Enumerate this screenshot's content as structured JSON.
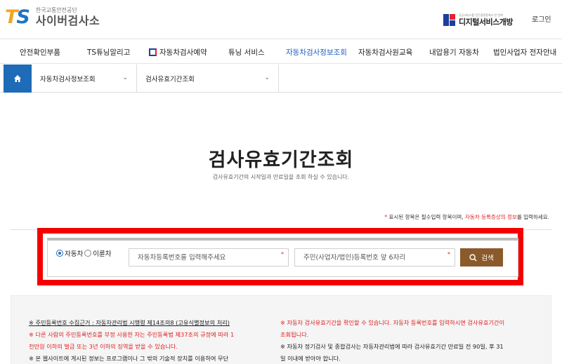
{
  "header": {
    "logo_mark": "TS",
    "org_name": "한국교통안전공단",
    "site_name": "사이버검사소",
    "gov_small": "공공서비스를 민간플랫폼에서 한 번에",
    "gov_title": "디지털서비스개방",
    "login_label": "로그인"
  },
  "gnb": [
    {
      "label": "안전확인부품"
    },
    {
      "label": "TS튜닝알리고"
    },
    {
      "label": "자동차검사예약"
    },
    {
      "label": "튜닝 서비스"
    },
    {
      "label": "자동차검사정보조회"
    },
    {
      "label": "자동차검사원교육"
    },
    {
      "label": "내압용기 자동차"
    },
    {
      "label": "법인사업자 전자안내"
    }
  ],
  "gnb_active": "자동차검사정보조회",
  "location": {
    "level1": "자동차검사정보조회",
    "level2": "검사유효기간조회"
  },
  "page": {
    "title": "검사유효기간조회",
    "subtitle": "검사유효기간의 시작일과 만료일을 조회 하실 수 있습니다."
  },
  "req_note": {
    "star": "*",
    "text1": " 표시된 항목은 필수입력 항목이며, ",
    "red": "자동차 등록증상의 정보",
    "text2": "를 입력하세요."
  },
  "search": {
    "radio_car": "자동차",
    "radio_bike": "이륜차",
    "selected": "자동차",
    "car_no_placeholder": "자동차등록번호를 입력해주세요",
    "id_placeholder": "주민(사업자/법인)등록번호 앞 6자리",
    "required_mark": "*",
    "button_label": "검색"
  },
  "notice": {
    "left": [
      {
        "text": "※ 주민등록번호 수집근거 : 자동차관리법 시행령 제14조의8 (고유식별정보의 처리)",
        "style": "underline"
      },
      {
        "text": "※ 다른 사람의 주민등록번호를 부정 사용한 자는 주민등록법 제37조의 규정에 따라 1",
        "style": "red"
      },
      {
        "text": "천만원 이하의 벌금 또는 3년 이하의 징역을 받을 수 있습니다.",
        "style": "red"
      },
      {
        "text": "※ 본 웹사이트에 게시된 정보는 프로그램이나 그 밖의 기술적 장치를 이용하여 무단",
        "style": "dark"
      }
    ],
    "right": [
      {
        "text": "※ 자동차 검사유효기간을 확인할 수 있습니다. 자동차 등록번호를 입력하시면 검사유효기간이",
        "style": "red"
      },
      {
        "text": "조회됩니다.",
        "style": "red"
      },
      {
        "text": "※ 자동차 정기검사 및 종합검사는 자동차관리법에 따라 검사유효기간 만료일 전 90일, 후 31",
        "style": "dark"
      },
      {
        "text": "일 이내에 받아야 합니다.",
        "style": "dark"
      }
    ]
  },
  "colors": {
    "brand_blue": "#1e6bb8",
    "logo_orange": "#f2a61f",
    "highlight_red": "#f50000",
    "search_button": "#8b5a2b",
    "active_menu": "#1d5fc0"
  },
  "icons": {
    "home": "home-icon",
    "chevron": "chevron-down-icon",
    "search": "search-icon"
  }
}
